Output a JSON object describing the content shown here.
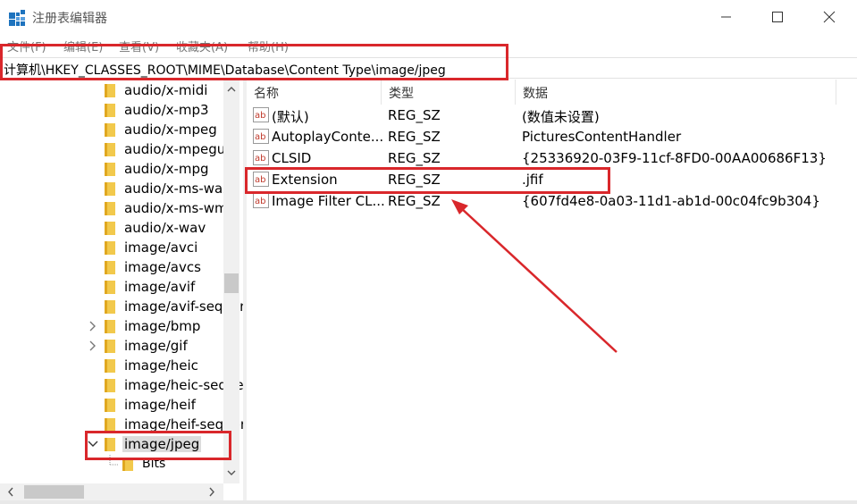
{
  "window": {
    "title": "注册表编辑器",
    "icon": "registry-editor-icon"
  },
  "menu": [
    "文件(F)",
    "编辑(E)",
    "查看(V)",
    "收藏夹(A)",
    "帮助(H)"
  ],
  "address": "计算机\\HKEY_CLASSES_ROOT\\MIME\\Database\\Content Type\\image/jpeg",
  "tree": {
    "items": [
      {
        "label": "audio/x-midi",
        "expander": ""
      },
      {
        "label": "audio/x-mp3",
        "expander": ""
      },
      {
        "label": "audio/x-mpeg",
        "expander": ""
      },
      {
        "label": "audio/x-mpegurl",
        "expander": ""
      },
      {
        "label": "audio/x-mpg",
        "expander": ""
      },
      {
        "label": "audio/x-ms-wax",
        "expander": ""
      },
      {
        "label": "audio/x-ms-wma",
        "expander": ""
      },
      {
        "label": "audio/x-wav",
        "expander": ""
      },
      {
        "label": "image/avci",
        "expander": ""
      },
      {
        "label": "image/avcs",
        "expander": ""
      },
      {
        "label": "image/avif",
        "expander": ""
      },
      {
        "label": "image/avif-sequence",
        "expander": ""
      },
      {
        "label": "image/bmp",
        "expander": ">"
      },
      {
        "label": "image/gif",
        "expander": ">"
      },
      {
        "label": "image/heic",
        "expander": ""
      },
      {
        "label": "image/heic-sequence",
        "expander": ""
      },
      {
        "label": "image/heif",
        "expander": ""
      },
      {
        "label": "image/heif-sequence",
        "expander": ""
      },
      {
        "label": "image/jpeg",
        "expander": "v",
        "selected": true
      },
      {
        "label": "Bits",
        "expander": "",
        "child": true
      }
    ]
  },
  "list": {
    "headers": {
      "name": "名称",
      "type": "类型",
      "data": "数据"
    },
    "rows": [
      {
        "name": "(默认)",
        "type": "REG_SZ",
        "data": "(数值未设置)"
      },
      {
        "name": "AutoplayConte...",
        "type": "REG_SZ",
        "data": "PicturesContentHandler"
      },
      {
        "name": "CLSID",
        "type": "REG_SZ",
        "data": "{25336920-03F9-11cf-8FD0-00AA00686F13}"
      },
      {
        "name": "Extension",
        "type": "REG_SZ",
        "data": ".jfif"
      },
      {
        "name": "Image Filter CL...",
        "type": "REG_SZ",
        "data": "{607fd4e8-0a03-11d1-ab1d-00c04fc9b304}"
      }
    ]
  },
  "colors": {
    "annotation": "#d9272b",
    "folder": "#f2c94c",
    "icon_blue": "#1e73be"
  }
}
